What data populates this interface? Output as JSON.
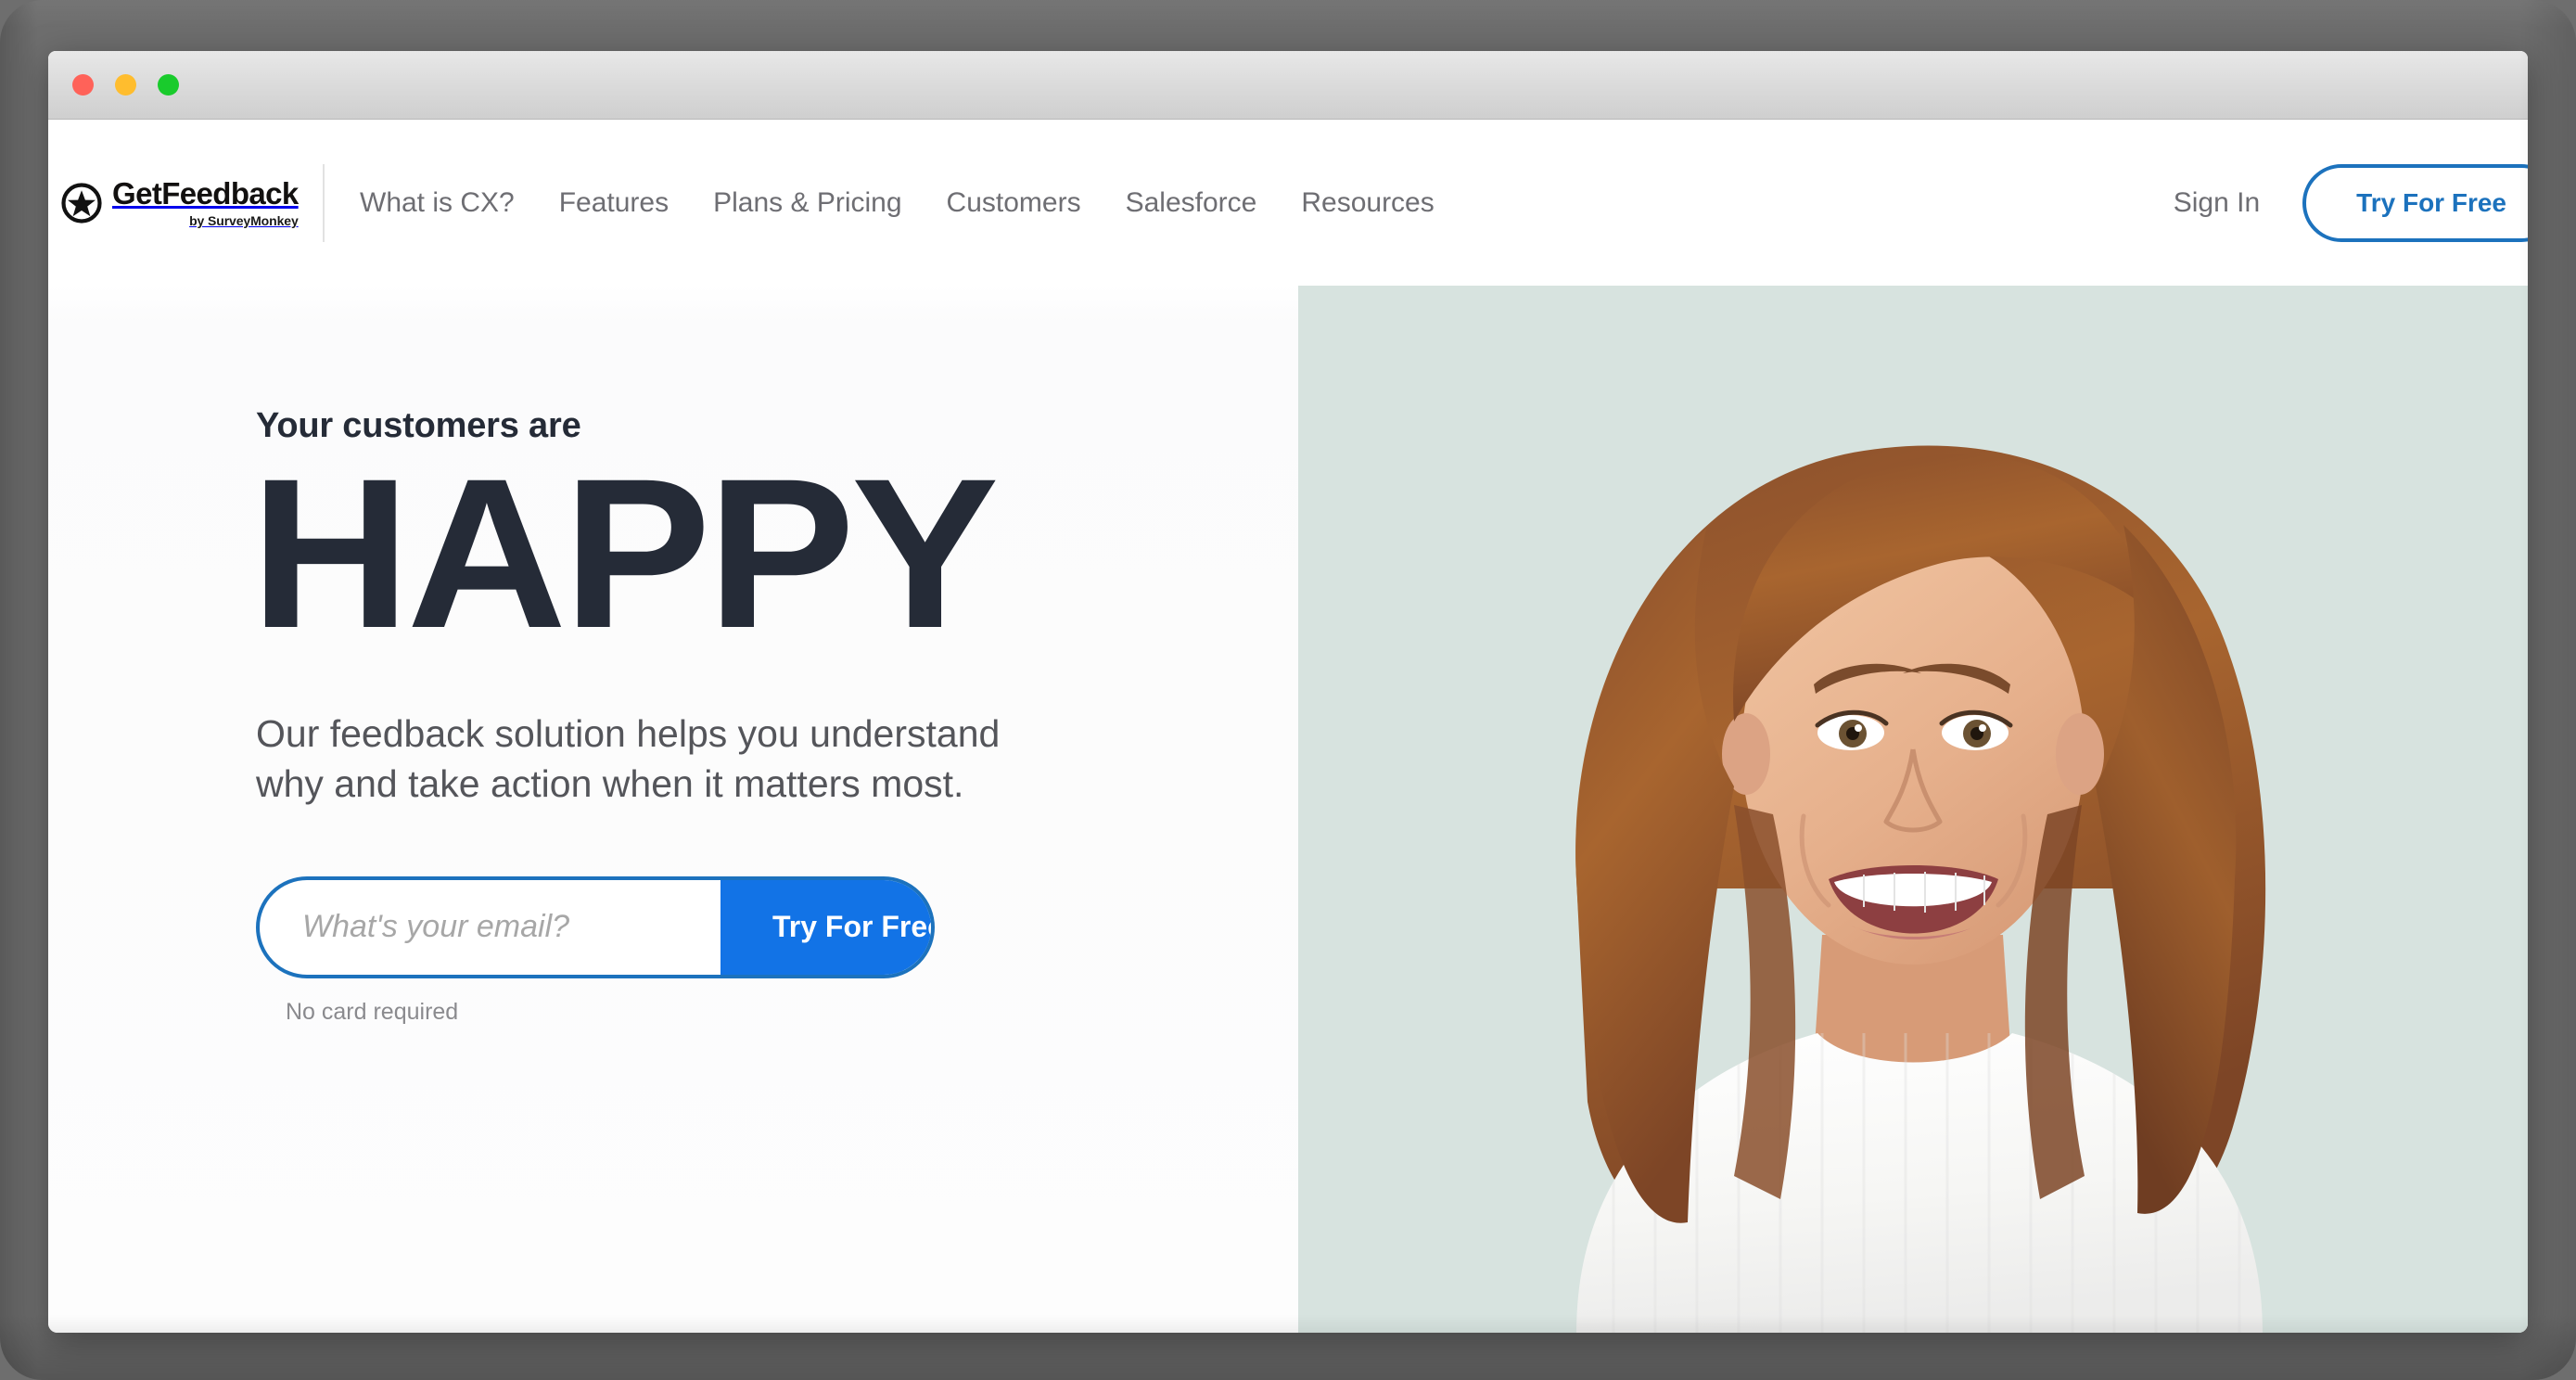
{
  "window": {
    "traffic_lights": [
      {
        "name": "close",
        "color": "#ff6259"
      },
      {
        "name": "minimize",
        "color": "#ffbd2e"
      },
      {
        "name": "maximize",
        "color": "#19cb2c"
      }
    ]
  },
  "header": {
    "logo": {
      "icon": "star-in-circle-icon",
      "name": "GetFeedback",
      "tagline": "by SurveyMonkey"
    },
    "nav_items": [
      {
        "label": "What is CX?"
      },
      {
        "label": "Features"
      },
      {
        "label": "Plans & Pricing"
      },
      {
        "label": "Customers"
      },
      {
        "label": "Salesforce"
      },
      {
        "label": "Resources"
      }
    ],
    "sign_in_label": "Sign In",
    "cta_label": "Try For Free"
  },
  "hero": {
    "eyebrow": "Your customers are",
    "headline": "HAPPY",
    "subcopy": "Our feedback solution helps you understand why and take action when it matters most.",
    "form": {
      "email_placeholder": "What's your email?",
      "email_value": "",
      "submit_label": "Try For Free",
      "footnote": "No card required"
    },
    "image": {
      "alt": "Smiling woman with auburn wavy hair wearing a white ribbed turtleneck",
      "background_color": "#d7e3df"
    }
  },
  "colors": {
    "brand_blue": "#1273e6",
    "outline_blue": "#1c72bd",
    "headline_navy": "#252b37",
    "body_gray": "#54555a",
    "nav_gray": "#6e6e73",
    "mint_background": "#d7e3df",
    "desktop_gray": "#6e6e6e"
  }
}
